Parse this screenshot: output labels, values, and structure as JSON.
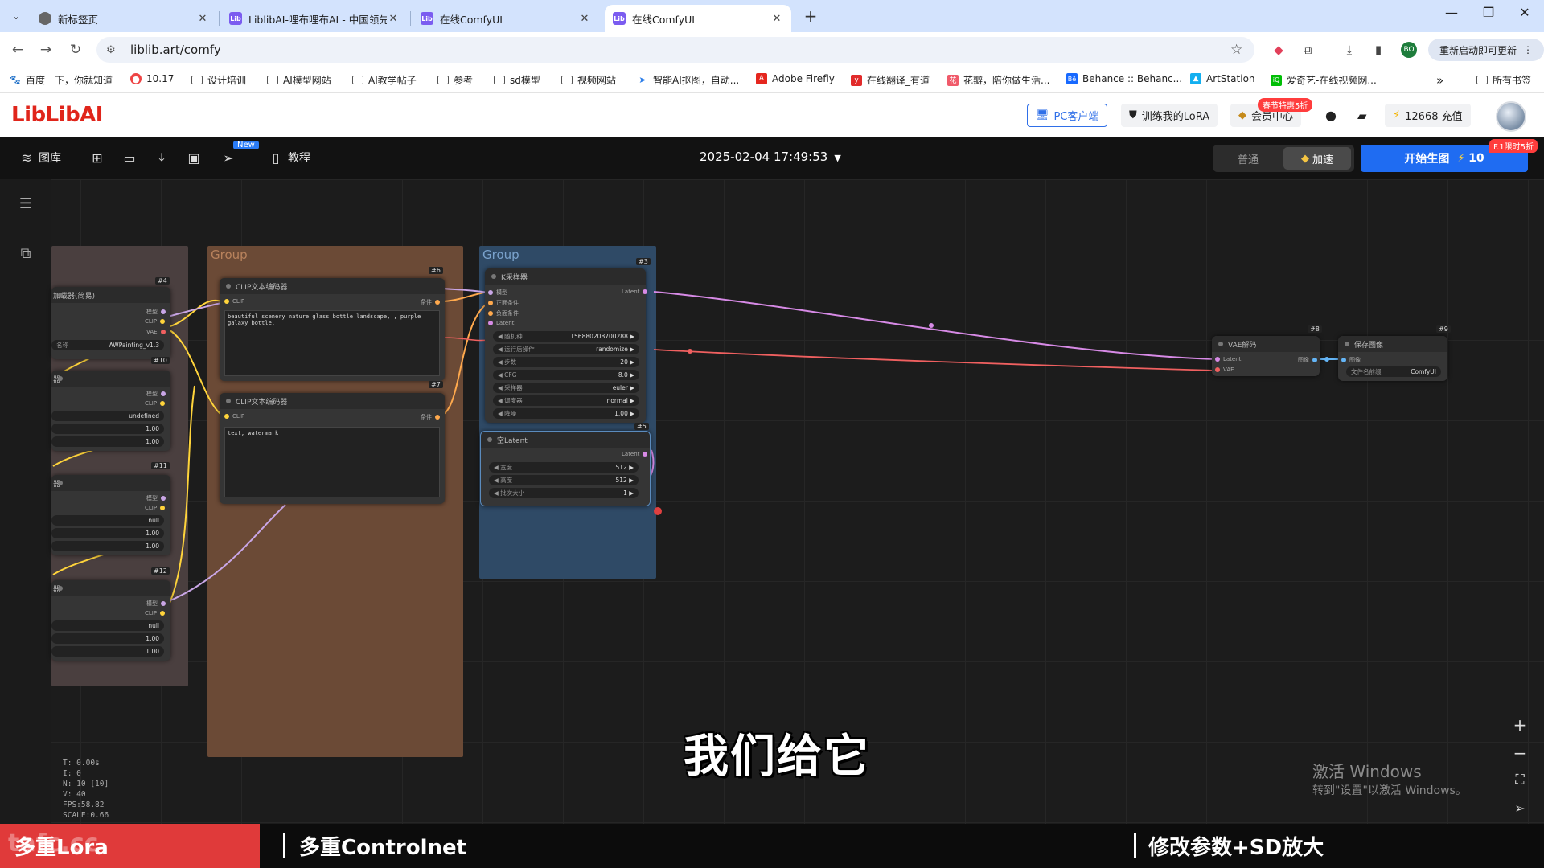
{
  "browser": {
    "tabs": [
      {
        "title": "新标签页",
        "favicon": "globe-icon",
        "active": false
      },
      {
        "title": "LiblibAI-哩布哩布AI - 中国领先…",
        "favicon": "liblib-icon",
        "active": false
      },
      {
        "title": "在线ComfyUI",
        "favicon": "liblib-icon",
        "active": false
      },
      {
        "title": "在线ComfyUI",
        "favicon": "liblib-icon",
        "active": true
      }
    ],
    "url": "liblib.art/comfy",
    "restart_label": "重新启动即可更新",
    "profile_label": "BO",
    "bookmarks": [
      {
        "label": "百度一下，你就知道",
        "icon": "baidu-icon"
      },
      {
        "label": "10.17",
        "icon": "chrome-icon"
      },
      {
        "label": "设计培训",
        "icon": "folder-icon"
      },
      {
        "label": "AI模型网站",
        "icon": "folder-icon"
      },
      {
        "label": "AI教学帖子",
        "icon": "folder-icon"
      },
      {
        "label": "参考",
        "icon": "folder-icon"
      },
      {
        "label": "sd模型",
        "icon": "folder-icon"
      },
      {
        "label": "视频网站",
        "icon": "folder-icon"
      },
      {
        "label": "智能AI抠图，自动...",
        "icon": "ai-icon"
      },
      {
        "label": "Adobe Firefly",
        "icon": "adobe-icon"
      },
      {
        "label": "在线翻译_有道",
        "icon": "youdao-icon"
      },
      {
        "label": "花瓣，陪你做生活...",
        "icon": "huaban-icon"
      },
      {
        "label": "Behance :: Behanc...",
        "icon": "behance-icon"
      },
      {
        "label": "ArtStation",
        "icon": "artstation-icon"
      },
      {
        "label": "爱奇艺-在线视频网...",
        "icon": "iqiyi-icon"
      }
    ],
    "bookmarks_overflow": "»",
    "all_bookmarks": "所有书签"
  },
  "liblib": {
    "logo": "LibLibAI",
    "pc_client": "PC客户端",
    "train_lora": "训练我的LoRA",
    "member_center": "会员中心",
    "member_promo": "春节特惠5折",
    "credits": "12668 充值"
  },
  "comfybar": {
    "gallery": "图库",
    "new_badge": "New",
    "tutorial": "教程",
    "datetime": "2025-02-04 17:49:53",
    "mode_normal": "普通",
    "mode_fast": "加速",
    "generate": "开始生图",
    "generate_cost": "10",
    "generate_badge": "F.1限时5折"
  },
  "groups": [
    {
      "title": ""
    },
    {
      "title": "Group"
    },
    {
      "title": "Group"
    }
  ],
  "nodes": {
    "lora_nodes": [
      {
        "id": "#4",
        "title": "加载器(简易)",
        "outputs": [
          "模型",
          "CLIP",
          "VAE"
        ],
        "widgets": [
          {
            "label": "名称",
            "value": "AWPainting_v1.3"
          }
        ]
      },
      {
        "id": "#10",
        "title": "器",
        "outputs": [
          "模型",
          "CLIP"
        ],
        "widgets": [
          {
            "label": "",
            "value": "undefined"
          },
          {
            "label": "",
            "value": "1.00"
          },
          {
            "label": "",
            "value": "1.00"
          }
        ]
      },
      {
        "id": "#11",
        "title": "器",
        "outputs": [
          "模型",
          "CLIP"
        ],
        "widgets": [
          {
            "label": "",
            "value": "null"
          },
          {
            "label": "",
            "value": "1.00"
          },
          {
            "label": "",
            "value": "1.00"
          }
        ]
      },
      {
        "id": "#12",
        "title": "器",
        "outputs": [
          "模型",
          "CLIP"
        ],
        "widgets": [
          {
            "label": "",
            "value": "null"
          },
          {
            "label": "",
            "value": "1.00"
          },
          {
            "label": "",
            "value": "1.00"
          }
        ]
      }
    ],
    "clip_pos": {
      "id": "#6",
      "title": "CLIP文本编码器",
      "input": "CLIP",
      "output": "条件",
      "text": "beautiful scenery nature glass bottle landscape, , purple galaxy bottle,"
    },
    "clip_neg": {
      "id": "#7",
      "title": "CLIP文本编码器",
      "input": "CLIP",
      "output": "条件",
      "text": "text, watermark"
    },
    "ksampler": {
      "id": "#3",
      "title": "K采样器",
      "inputs": [
        "模型",
        "正面条件",
        "负面条件",
        "Latent"
      ],
      "output": "Latent",
      "widgets": [
        {
          "label": "随机种",
          "value": "156880208700288"
        },
        {
          "label": "运行后操作",
          "value": "randomize"
        },
        {
          "label": "步数",
          "value": "20"
        },
        {
          "label": "CFG",
          "value": "8.0"
        },
        {
          "label": "采样器",
          "value": "euler"
        },
        {
          "label": "调度器",
          "value": "normal"
        },
        {
          "label": "降噪",
          "value": "1.00"
        }
      ]
    },
    "empty_latent": {
      "id": "#5",
      "title": "空Latent",
      "output": "Latent",
      "widgets": [
        {
          "label": "宽度",
          "value": "512"
        },
        {
          "label": "高度",
          "value": "512"
        },
        {
          "label": "批次大小",
          "value": "1"
        }
      ]
    },
    "vae_decode": {
      "id": "#8",
      "title": "VAE解码",
      "inputs": [
        "Latent",
        "VAE"
      ],
      "output": "图像"
    },
    "save_image": {
      "id": "#9",
      "title": "保存图像",
      "input": "图像",
      "widget": {
        "label": "文件名前缀",
        "value": "ComfyUI"
      }
    }
  },
  "stats": [
    "T: 0.00s",
    "I: 0",
    "N: 10 [10]",
    "V: 40",
    "FPS:58.82",
    "SCALE:0.66"
  ],
  "windows_activation": {
    "line1": "激活 Windows",
    "line2": "转到\"设置\"以激活 Windows。"
  },
  "subtitle": "我们给它",
  "bottom_bar": {
    "segments": [
      "多重Lora",
      "多重Controlnet",
      "修改参数+SD放大"
    ],
    "watermark": "tafc.cc"
  }
}
